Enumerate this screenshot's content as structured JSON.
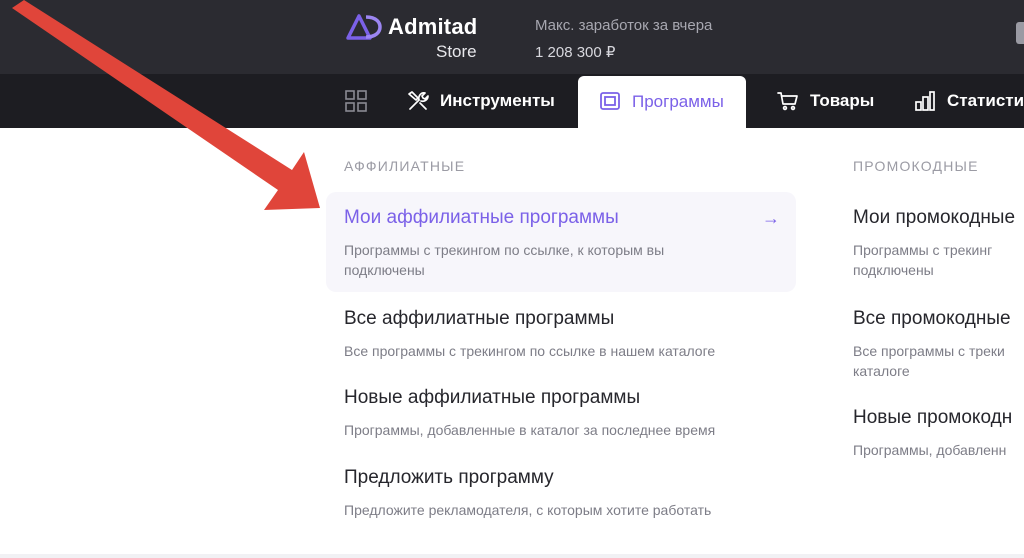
{
  "header": {
    "logo_name": "Admitad",
    "logo_sub": "Store",
    "earnings_label": "Макс. заработок за вчера",
    "earnings_value": "1 208 300 ₽"
  },
  "nav": {
    "items": [
      {
        "label": "",
        "icon": "grid-icon"
      },
      {
        "label": "Инструменты",
        "icon": "tools-icon"
      },
      {
        "label": "Программы",
        "icon": "monitor-icon",
        "active": true
      },
      {
        "label": "Товары",
        "icon": "cart-icon"
      },
      {
        "label": "Статисти",
        "icon": "bar-chart-icon"
      }
    ]
  },
  "affiliate": {
    "title": "АФФИЛИАТНЫЕ",
    "items": [
      {
        "title": "Мои аффилиатные программы",
        "desc": "Программы с трекингом по ссылке, к которым вы подключены",
        "highlight": true
      },
      {
        "title": "Все аффилиатные программы",
        "desc": "Все программы с трекингом по ссылке в нашем каталоге"
      },
      {
        "title": "Новые аффилиатные программы",
        "desc": "Программы, добавленные в каталог за последнее время"
      },
      {
        "title": "Предложить программу",
        "desc": "Предложите рекламодателя, с которым хотите работать"
      }
    ]
  },
  "promo": {
    "title": "ПРОМОКОДНЫЕ",
    "items": [
      {
        "title": "Мои промокодные",
        "desc_line1": "Программы с трекинг",
        "desc_line2": "подключены"
      },
      {
        "title": "Все промокодные",
        "desc_line1": "Все программы с треки",
        "desc_line2": "каталоге"
      },
      {
        "title": "Новые промокодн",
        "desc_line1": "Программы, добавленн"
      }
    ]
  },
  "colors": {
    "accent": "#7b61e8",
    "header_bg": "#2b2b31",
    "nav_bg": "#1d1d22",
    "annotation_arrow": "#e0453a"
  }
}
